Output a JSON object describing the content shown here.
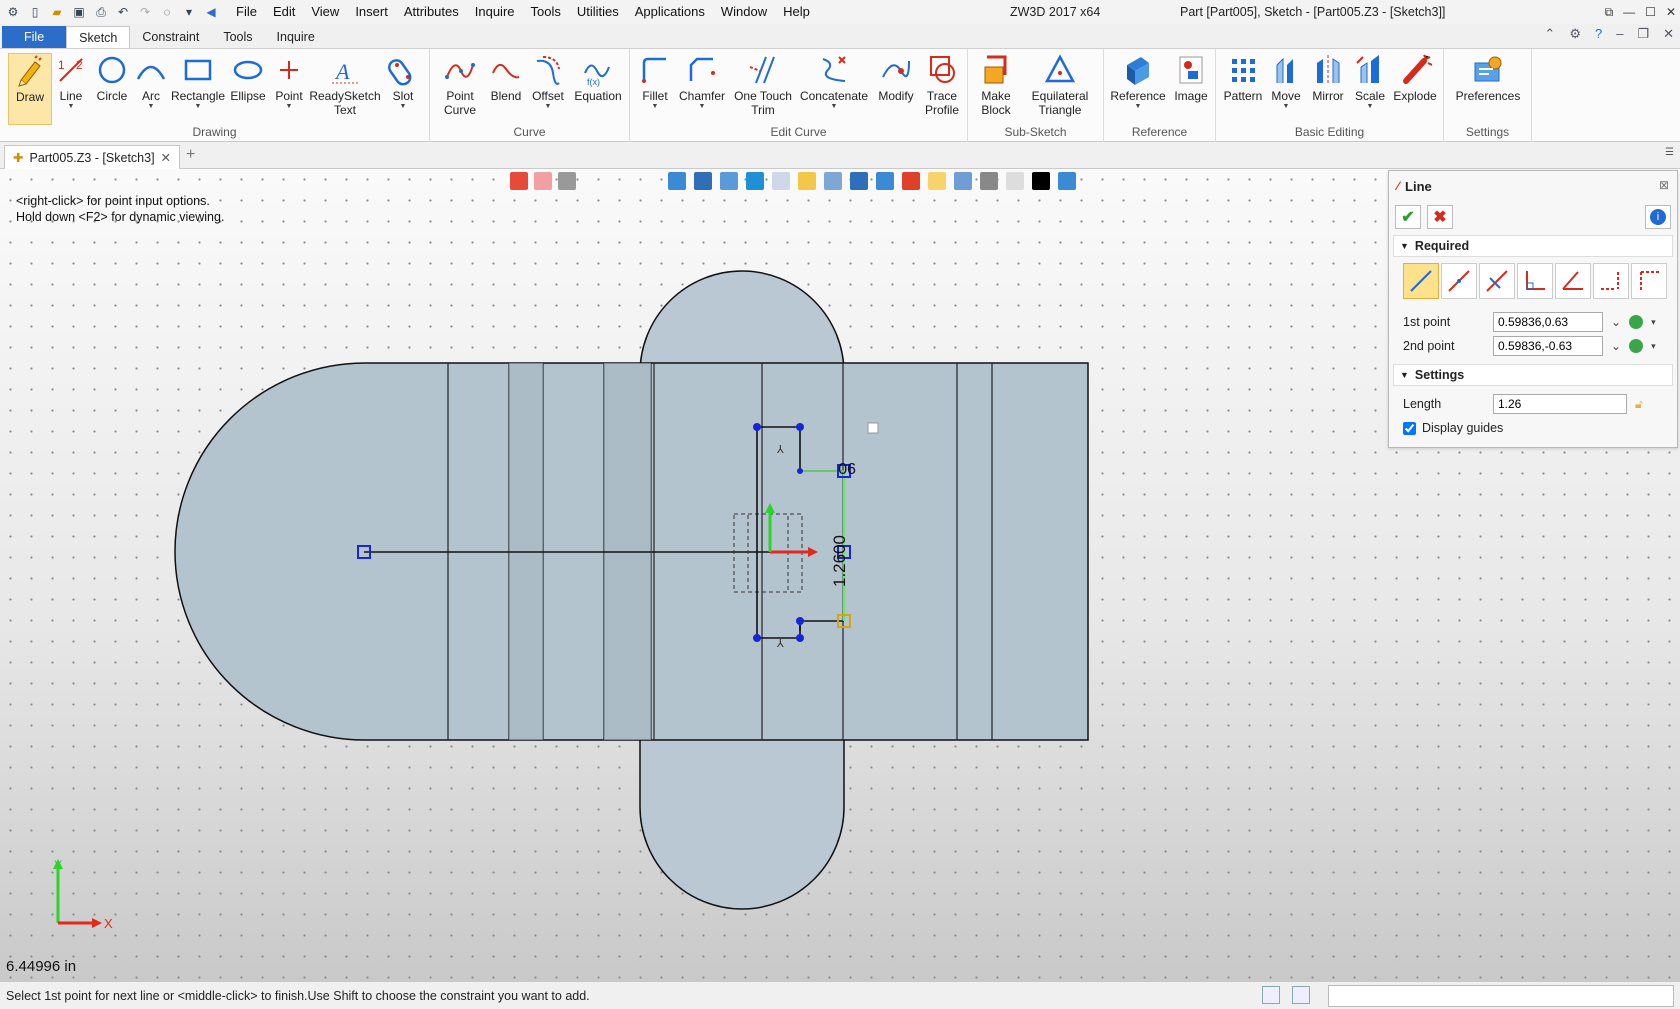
{
  "window": {
    "menu": [
      "File",
      "Edit",
      "View",
      "Insert",
      "Attributes",
      "Inquire",
      "Tools",
      "Utilities",
      "Applications",
      "Window",
      "Help"
    ],
    "app_title": "ZW3D 2017  x64",
    "doc_title": "Part [Part005],  Sketch - [Part005.Z3 - [Sketch3]]"
  },
  "ribbon_tabs": [
    "File",
    "Sketch",
    "Constraint",
    "Tools",
    "Inquire"
  ],
  "ribbon": {
    "drawing": {
      "label": "Drawing",
      "buttons": [
        "Draw",
        "Line",
        "Circle",
        "Arc",
        "Rectangle",
        "Ellipse",
        "Point",
        "ReadySketch\nText",
        "Slot"
      ]
    },
    "curve": {
      "label": "Curve",
      "buttons": [
        "Point\nCurve",
        "Blend",
        "Offset",
        "Equation"
      ]
    },
    "edit_curve": {
      "label": "Edit Curve",
      "buttons": [
        "Fillet",
        "Chamfer",
        "One Touch\nTrim",
        "Concatenate",
        "Modify",
        "Trace\nProfile"
      ]
    },
    "sub_sketch": {
      "label": "Sub-Sketch",
      "buttons": [
        "Make\nBlock",
        "Equilateral\nTriangle"
      ]
    },
    "reference": {
      "label": "Reference",
      "buttons": [
        "Reference",
        "Image"
      ]
    },
    "basic_editing": {
      "label": "Basic Editing",
      "buttons": [
        "Pattern",
        "Move",
        "Mirror",
        "Scale",
        "Explode"
      ]
    },
    "settings": {
      "label": "Settings",
      "buttons": [
        "Preferences"
      ]
    }
  },
  "doc_tab": {
    "label": "Part005.Z3 - [Sketch3]"
  },
  "viewport": {
    "hint_line1": "<right-click> for point input options.",
    "hint_line2": "Hold down <F2> for dynamic viewing.",
    "dimension_label": "1.2600",
    "angle_label": "90",
    "unit_readout": "6.44996 in",
    "axis_x": "X",
    "axis_y": "Y"
  },
  "line_panel": {
    "title": "Line",
    "required_label": "Required",
    "first_point_label": "1st point",
    "first_point_value": "0.59836,0.63",
    "second_point_label": "2nd point",
    "second_point_value": "0.59836,-0.63",
    "settings_label": "Settings",
    "length_label": "Length",
    "length_value": "1.26",
    "display_guides_label": "Display guides",
    "display_guides_checked": true
  },
  "status": {
    "message": "Select 1st point for next line or <middle-click> to finish.Use Shift to choose the constraint you want to add."
  },
  "colors": {
    "file_tab": "#2b6dc9",
    "active_tool": "#fde7a8",
    "shape_fill": "#b9c8d2",
    "sketch_line_green": "#6fe36f",
    "point_blue": "#1426d6"
  }
}
